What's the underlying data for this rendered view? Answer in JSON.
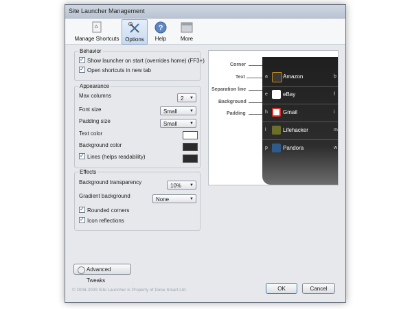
{
  "window": {
    "title": "Site Launcher Management"
  },
  "toolbar": {
    "items": [
      {
        "label": "Manage Shortcuts",
        "icon": "shortcuts-icon"
      },
      {
        "label": "Options",
        "icon": "tools-icon",
        "active": true
      },
      {
        "label": "Help",
        "icon": "help-icon"
      },
      {
        "label": "More",
        "icon": "more-icon"
      }
    ]
  },
  "behavior": {
    "title": "Behavior",
    "show_launcher": {
      "label": "Show launcher on start (overrides home) (FF3+)",
      "checked": true
    },
    "open_new_tab": {
      "label": "Open shortcuts in new tab",
      "checked": true
    }
  },
  "appearance": {
    "title": "Appearance",
    "max_columns": {
      "label": "Max columns",
      "value": "2"
    },
    "font_size": {
      "label": "Font size",
      "value": "Small"
    },
    "padding_size": {
      "label": "Padding size",
      "value": "Small"
    },
    "text_color": {
      "label": "Text color",
      "color": "#ffffff"
    },
    "background_color": {
      "label": "Background color",
      "color": "#2b2b2b"
    },
    "lines": {
      "label": "Lines (helps readability)",
      "checked": true,
      "color": "#2b2b2b"
    }
  },
  "effects": {
    "title": "Effects",
    "bg_transparency": {
      "label": "Background transparency",
      "value": "10%"
    },
    "gradient_bg": {
      "label": "Gradient background",
      "value": "None"
    },
    "rounded": {
      "label": "Rounded corners",
      "checked": true
    },
    "reflections": {
      "label": "Icon reflections",
      "checked": true
    }
  },
  "preview": {
    "labels": {
      "corner": "Corner",
      "text": "Text",
      "separation": "Separation line",
      "background": "Background",
      "padding": "Padding"
    },
    "rows": [
      {
        "key": "a",
        "name": "Amazon",
        "key2": "b",
        "icon_color": "#3a3a3a"
      },
      {
        "key": "e",
        "name": "eBay",
        "key2": "f",
        "icon_color": "#ffffff"
      },
      {
        "key": "h",
        "name": "Gmail",
        "key2": "i",
        "icon_color": "#d93025"
      },
      {
        "key": "l",
        "name": "Lifehacker",
        "key2": "m",
        "icon_color": "#6b6f2a"
      },
      {
        "key": "p",
        "name": "Pandora",
        "key2": "w",
        "icon_color": "#2f5b8a"
      }
    ]
  },
  "advanced_button": "Advanced Tweaks",
  "footer": "© 2008-2009 Site Launcher is Property of Done Smart Ltd.",
  "ok_button": "OK",
  "cancel_button": "Cancel"
}
